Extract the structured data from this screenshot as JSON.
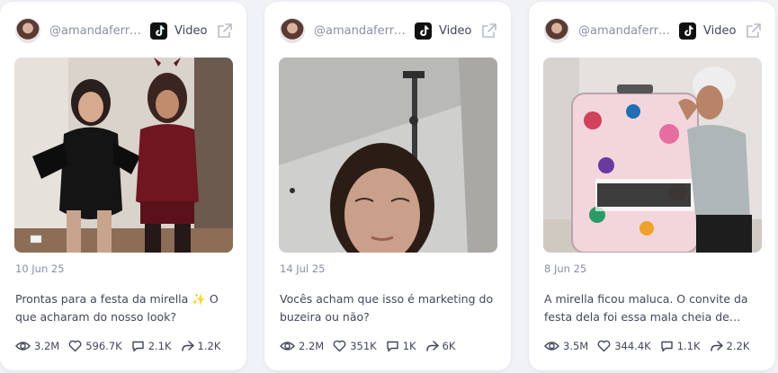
{
  "posts": [
    {
      "handle": "@amandaferre...",
      "type": "Video",
      "date": "10 Jun 25",
      "caption": "Prontas para a festa da mirella ✨ O que acharam do nosso look?",
      "views": "3.2M",
      "likes": "596.7K",
      "comments": "2.1K",
      "shares": "1.2K"
    },
    {
      "handle": "@amandaferre...",
      "type": "Video",
      "date": "14 Jul 25",
      "caption": "Vocês acham que isso é marketing do buzeira ou não?",
      "views": "2.2M",
      "likes": "351K",
      "comments": "1K",
      "shares": "6K"
    },
    {
      "handle": "@amandaferre...",
      "type": "Video",
      "date": "8 Jun 25",
      "caption": "A mirella ficou maluca. O convite da festa dela foi essa mala cheia de…",
      "views": "3.5M",
      "likes": "344.4K",
      "comments": "1.1K",
      "shares": "2.2K"
    }
  ],
  "icons": {
    "platform": "tiktok-icon",
    "open": "external-link-icon",
    "views": "eye-icon",
    "likes": "heart-icon",
    "comments": "comment-icon",
    "shares": "share-icon"
  },
  "colors": {
    "page_bg": "#f1f2f6",
    "card_bg": "#ffffff",
    "text": "#41475a",
    "muted": "#8a8fa3"
  }
}
